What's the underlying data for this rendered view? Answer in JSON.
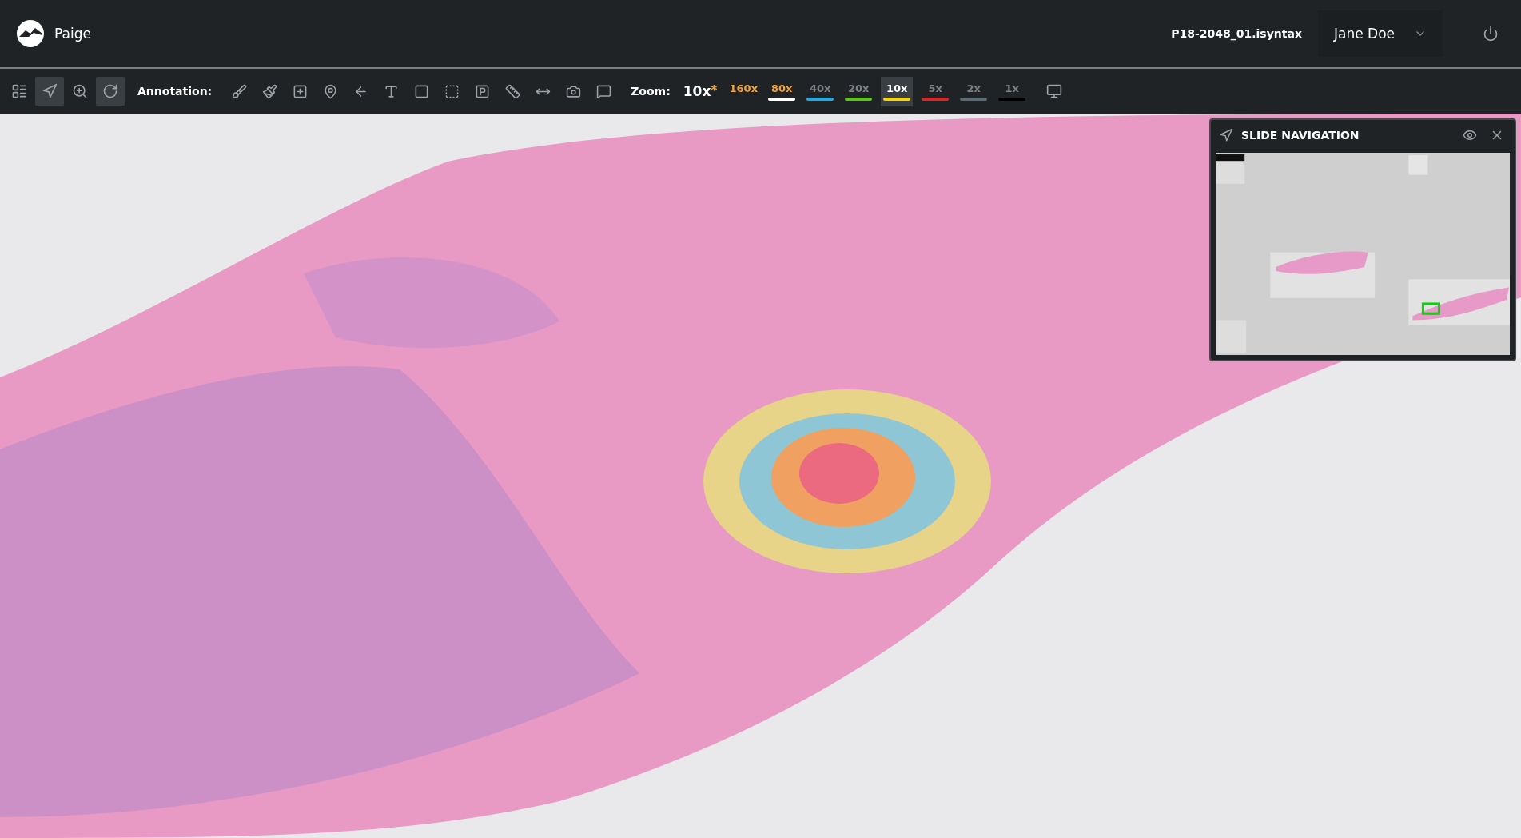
{
  "header": {
    "brand": "Paige",
    "file_name": "P18-2048_01.isyntax",
    "user": "Jane Doe"
  },
  "toolbar": {
    "view_tools": [
      {
        "selected": false
      },
      {
        "selected": true
      },
      {
        "selected": false
      },
      {
        "selected": true
      }
    ],
    "annotation_label": "Annotation:",
    "zoom_label": "Zoom:",
    "zoom_current": "10x",
    "zoom_mark": "*",
    "zoom_levels": [
      {
        "label": "160x",
        "highlighted": true,
        "selected": false
      },
      {
        "label": "80x",
        "highlighted": true,
        "selected": false,
        "color": "#ffffff"
      },
      {
        "label": "40x",
        "highlighted": false,
        "selected": false,
        "color": "#29a8e0"
      },
      {
        "label": "20x",
        "highlighted": false,
        "selected": false,
        "color": "#5cc21c"
      },
      {
        "label": "10x",
        "highlighted": false,
        "selected": true,
        "color": "#f2d21b"
      },
      {
        "label": "5x",
        "highlighted": false,
        "selected": false,
        "color": "#d62a2a"
      },
      {
        "label": "2x",
        "highlighted": false,
        "selected": false,
        "color": "#5b6b78"
      },
      {
        "label": "1x",
        "highlighted": false,
        "selected": false,
        "color": "#000000"
      }
    ]
  },
  "slide_navigation": {
    "title": "SLIDE NAVIGATION"
  }
}
